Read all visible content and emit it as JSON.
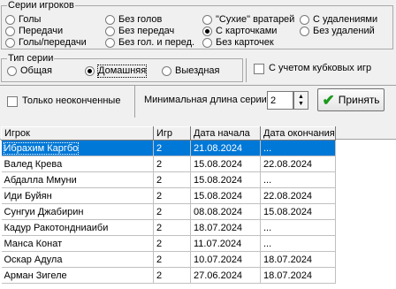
{
  "series_group": {
    "title": "Серии игроков",
    "col1": [
      "Голы",
      "Передачи",
      "Голы/передачи"
    ],
    "col2": [
      "Без голов",
      "Без передач",
      "Без гол. и перед."
    ],
    "col3": [
      "\"Сухие\" вратарей",
      "С карточками",
      "Без карточек"
    ],
    "col4": [
      "С удалениями",
      "Без удалений"
    ],
    "selected": "С карточками"
  },
  "type_group": {
    "title": "Тип серии",
    "options": [
      "Общая",
      "Домашняя",
      "Выездная"
    ],
    "selected": "Домашняя"
  },
  "cup_checkbox": {
    "label": "С учетом кубковых игр",
    "checked": false
  },
  "unfinished_checkbox": {
    "label": "Только неоконченные",
    "checked": false
  },
  "min_length": {
    "label": "Минимальная длина серии",
    "value": "2"
  },
  "apply_button": {
    "label": "Принять"
  },
  "table": {
    "columns": [
      "Игрок",
      "Игр",
      "Дата начала",
      "Дата окончания"
    ],
    "rows": [
      [
        "Ибрахим Каргбо",
        "2",
        "21.08.2024",
        "..."
      ],
      [
        "Валед Крева",
        "2",
        "15.08.2024",
        "22.08.2024"
      ],
      [
        "Абдалла Ммуни",
        "2",
        "15.08.2024",
        "..."
      ],
      [
        "Иди Буйян",
        "2",
        "15.08.2024",
        "22.08.2024"
      ],
      [
        "Сунгуи Джабирин",
        "2",
        "08.08.2024",
        "15.08.2024"
      ],
      [
        "Кадур Ракотондниаиби",
        "2",
        "18.07.2024",
        "..."
      ],
      [
        "Манса Конат",
        "2",
        "11.07.2024",
        "..."
      ],
      [
        "Оскар Адула",
        "2",
        "10.07.2024",
        "18.07.2024"
      ],
      [
        "Арман Зигеле",
        "2",
        "27.06.2024",
        "18.07.2024"
      ]
    ],
    "selected_row": 0
  }
}
